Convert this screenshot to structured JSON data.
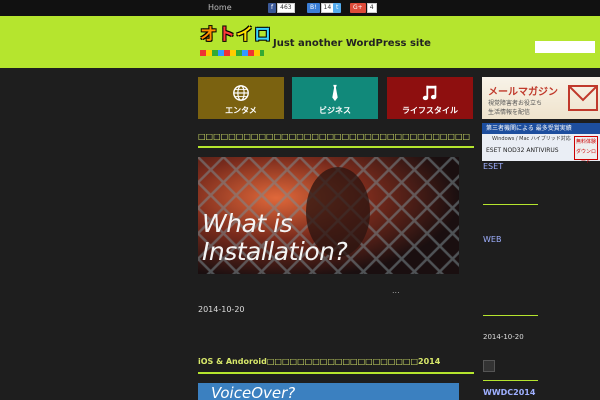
{
  "topbar": {
    "home": "Home",
    "share": [
      {
        "label": "f",
        "color": "#3b5998",
        "count": "463"
      },
      {
        "label": "B!",
        "color": "#3b7ed6",
        "count": "14"
      },
      {
        "label": "t",
        "color": "#55acee",
        "count": ""
      },
      {
        "label": "G+",
        "color": "#dd4b39",
        "count": "4"
      }
    ]
  },
  "header": {
    "logo": [
      "オ",
      "ト",
      "イ",
      "ロ"
    ],
    "tagline": "Just another WordPress site",
    "search_placeholder": ""
  },
  "categories": [
    {
      "label": "エンタメ",
      "icon": "globe-icon",
      "color": "#7b6210"
    },
    {
      "label": "ビジネス",
      "icon": "necktie-icon",
      "color": "#11897a"
    },
    {
      "label": "ライフスタイル",
      "icon": "music-note-icon",
      "color": "#8e0f0f"
    }
  ],
  "posts": [
    {
      "title": "□□□□□□□□□□□□□□□□□□□□□□□□□□□□□□□□□□□□",
      "image_text_1": "What is",
      "image_text_2": "Installation?",
      "more": "...",
      "date": "2014-10-20"
    },
    {
      "title": "iOS & Andoroid□□□□□□□□□□□□□□□□□□□□2014",
      "image_text_1": "VoiceOver?"
    }
  ],
  "sidebar": {
    "banner_mail": {
      "title": "メールマガジン",
      "line1": "視覚障害者お役立ち",
      "line2": "生活情報を配信"
    },
    "banner_eset": {
      "top": "第三者機関による 最多受賞実績",
      "mid": "Windows / Mac ハイブリッド対応",
      "product": "ESET NOD32 ANTIVIRUS",
      "badge": "無料体験 ダウンロード"
    },
    "links": [
      "ESET",
      "WEB"
    ],
    "date": "2014-10-20",
    "bottom_link": "WWDC2014"
  }
}
